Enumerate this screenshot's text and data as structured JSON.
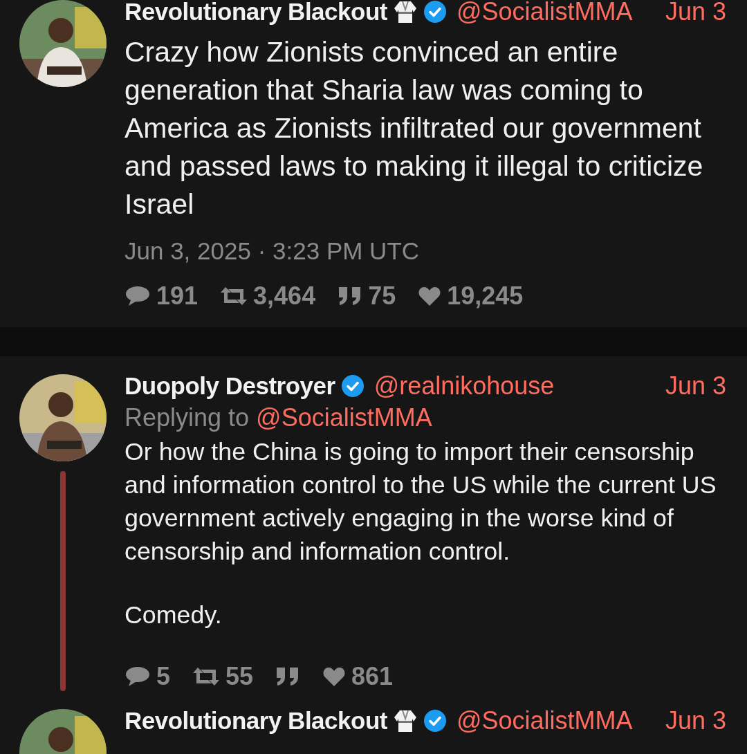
{
  "tweets": [
    {
      "name": "Revolutionary Blackout",
      "name_emoji": true,
      "verified": true,
      "handle": "@SocialistMMA",
      "date": "Jun 3",
      "main": true,
      "text": "Crazy how Zionists convinced an entire generation that Sharia law was coming to America as Zionists infiltrated our government and passed laws to making it illegal to criticize Israel",
      "published": "Jun 3, 2025 · 3:23 PM UTC",
      "stats": [
        {
          "kind": "reply",
          "count": "191"
        },
        {
          "kind": "retweet",
          "count": "3,464"
        },
        {
          "kind": "quote",
          "count": "75"
        },
        {
          "kind": "like",
          "count": "19,245"
        }
      ]
    },
    {
      "name": "Duopoly Destroyer",
      "name_emoji": false,
      "verified": true,
      "handle": "@realnikohouse",
      "date": "Jun 3",
      "main": false,
      "thread_continues": true,
      "replying_label": "Replying to",
      "replying_to": "@SocialistMMA",
      "paragraphs": [
        "Or how the China is going to import their censorship and information control to the US while the current US government actively engaging in the worse kind of censorship and information control.",
        "Comedy."
      ],
      "stats": [
        {
          "kind": "reply",
          "count": "5"
        },
        {
          "kind": "retweet",
          "count": "55"
        },
        {
          "kind": "quote"
        },
        {
          "kind": "like",
          "count": "861"
        }
      ]
    },
    {
      "name": "Revolutionary Blackout",
      "name_emoji": true,
      "verified": true,
      "handle": "@SocialistMMA",
      "date": "Jun 3",
      "main": false
    }
  ]
}
